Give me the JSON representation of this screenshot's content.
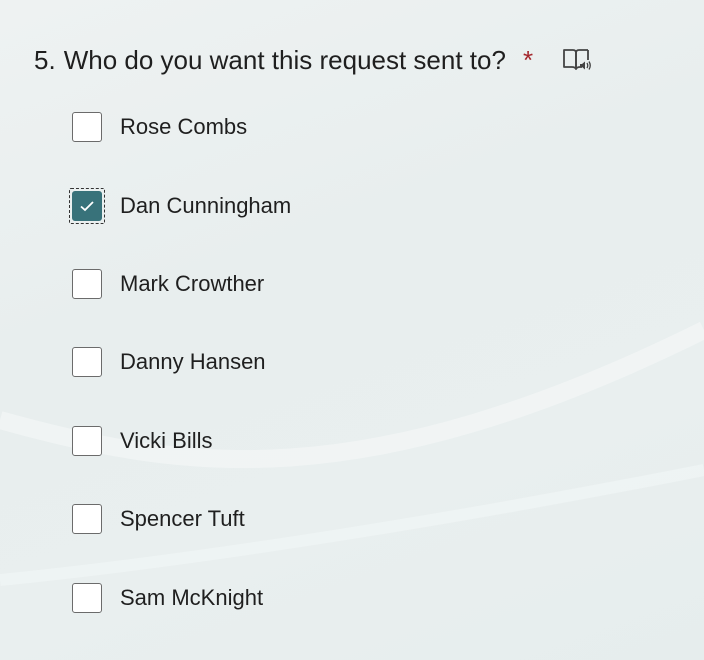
{
  "question": {
    "number": "5.",
    "text": "Who do you want this request sent to?",
    "required_marker": "*",
    "reader_icon": "immersive-reader-icon"
  },
  "options": [
    {
      "label": "Rose Combs",
      "checked": false
    },
    {
      "label": "Dan Cunningham",
      "checked": true
    },
    {
      "label": "Mark Crowther",
      "checked": false
    },
    {
      "label": "Danny Hansen",
      "checked": false
    },
    {
      "label": "Vicki Bills",
      "checked": false
    },
    {
      "label": "Spencer Tuft",
      "checked": false
    },
    {
      "label": "Sam McKnight",
      "checked": false
    }
  ],
  "colors": {
    "accent": "#38727a",
    "required": "#a4262c",
    "text": "#1f1f1f",
    "background": "#e9efef"
  }
}
